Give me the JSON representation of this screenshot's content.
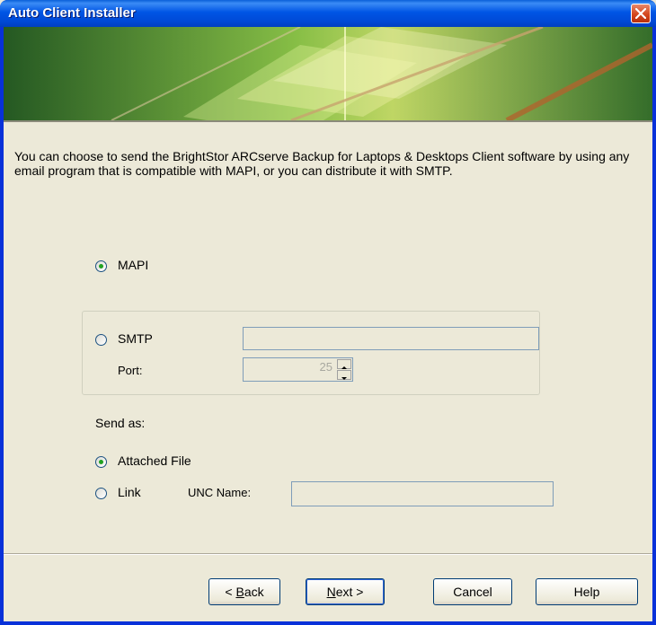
{
  "window": {
    "title": "Auto Client Installer"
  },
  "intro": "You can choose to send the BrightStor ARCserve Backup for Laptops & Desktops Client software by using any email program that is compatible with MAPI, or you can distribute it with SMTP.",
  "method": {
    "mapi_label": "MAPI",
    "mapi_selected": true,
    "smtp_label": "SMTP",
    "smtp_selected": false,
    "smtp_server_value": "",
    "port_label": "Port:",
    "port_value": "25"
  },
  "send_as": {
    "label": "Send as:",
    "attached_label": "Attached File",
    "attached_selected": true,
    "link_label": "Link",
    "link_selected": false,
    "unc_label": "UNC Name:",
    "unc_value": ""
  },
  "buttons": {
    "back_prefix": "< ",
    "back_mnemonic": "B",
    "back_rest": "ack",
    "next_mnemonic": "N",
    "next_rest": "ext >",
    "cancel": "Cancel",
    "help": "Help"
  },
  "colors": {
    "titlebar": "#0055e5",
    "dialog_bg": "#ece9d8",
    "radio_dot": "#21a121",
    "banner": "#5ca03a"
  }
}
